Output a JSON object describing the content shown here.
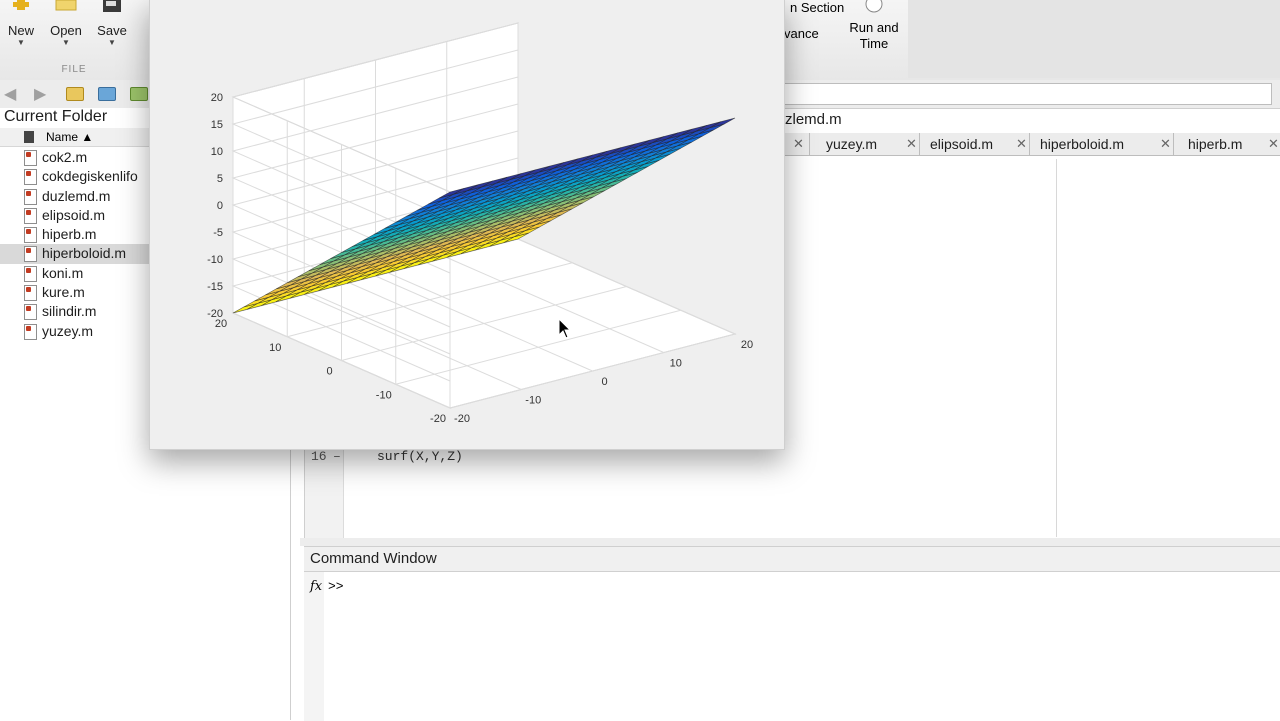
{
  "toolstrip": {
    "new_label": "New",
    "open_label": "Open",
    "save_label": "Save",
    "file_section": "FILE",
    "section_label_partial": "n Section",
    "advance_partial": "vance",
    "run_time_line1": "Run and",
    "run_time_line2": "Time"
  },
  "current_folder": {
    "title": "Current Folder",
    "name_header": "Name ▲",
    "files": [
      {
        "name": "cok2.m",
        "selected": false
      },
      {
        "name": "cokdegiskenlifo",
        "selected": false
      },
      {
        "name": "duzlemd.m",
        "selected": false
      },
      {
        "name": "elipsoid.m",
        "selected": false
      },
      {
        "name": "hiperb.m",
        "selected": false
      },
      {
        "name": "hiperboloid.m",
        "selected": true
      },
      {
        "name": "koni.m",
        "selected": false
      },
      {
        "name": "kure.m",
        "selected": false
      },
      {
        "name": "silindir.m",
        "selected": false
      },
      {
        "name": "yuzey.m",
        "selected": false
      }
    ]
  },
  "editor": {
    "title_partial": "zlemd.m",
    "tabs": [
      "yuzey.m",
      "elipsoid.m",
      "hiperboloid.m",
      "hiperb.m"
    ],
    "line_number": "16",
    "line_marker": "–",
    "code_line": "surf(X,Y,Z)"
  },
  "command_window": {
    "title": "Command Window",
    "fx": "fx",
    "prompt": ">>"
  },
  "chart_data": {
    "type": "surface",
    "z_ticks": [
      "20",
      "15",
      "10",
      "5",
      "0",
      "-5",
      "-10",
      "-15",
      "-20"
    ],
    "left_axis_ticks": [
      "20",
      "10",
      "0",
      "-10",
      "-20"
    ],
    "right_axis_ticks": [
      "-20",
      "-10",
      "0",
      "10",
      "20"
    ],
    "x_range": [
      -20,
      20
    ],
    "y_range": [
      -20,
      20
    ],
    "z_range": [
      -20,
      20
    ],
    "colormap": "parula",
    "grid": true
  }
}
